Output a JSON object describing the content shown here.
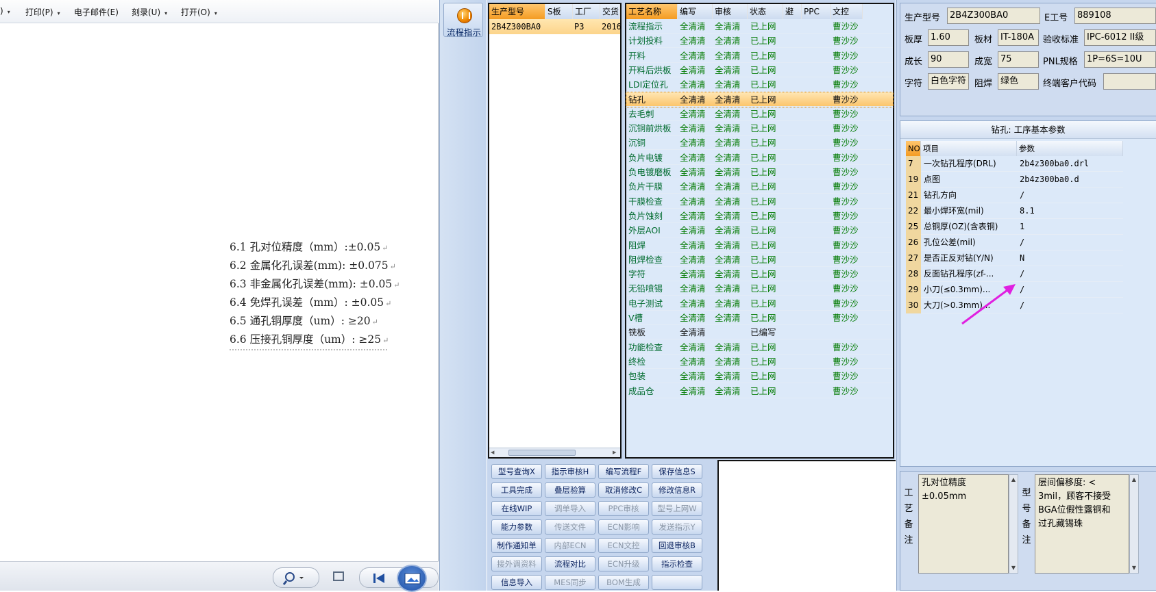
{
  "doc_toolbar": {
    "items": [
      {
        "label": ")",
        "arrow": "▾"
      },
      {
        "label": "打印(P)",
        "arrow": "▾"
      },
      {
        "label": "电子邮件(E)",
        "arrow": ""
      },
      {
        "label": "刻录(U)",
        "arrow": "▾"
      },
      {
        "label": "打开(O)",
        "arrow": "▾"
      }
    ]
  },
  "doc_lines": [
    "6.1 孔对位精度（mm）:±0.05",
    "6.2 金属化孔误差(mm): ±0.075",
    "6.3 非金属化孔误差(mm): ±0.05",
    "6.4 免焊孔误差（mm）: ±0.05",
    "6.5 通孔铜厚度（um）: ≥20",
    "6.6 压接孔铜厚度（um）: ≥25"
  ],
  "para_mark": "↵",
  "flow_button": {
    "label": "流程指示",
    "icon": "flow-indicator-icon"
  },
  "model_grid": {
    "headers": [
      "生产型号",
      "S板",
      "工厂",
      "交货"
    ],
    "row": [
      "2B4Z300BA0",
      "",
      "P3",
      "2016"
    ]
  },
  "process_grid": {
    "headers": [
      "工艺名称",
      "编写",
      "审核",
      "状态",
      "避",
      "PPC",
      "文控"
    ],
    "rows": [
      [
        "流程指示",
        "全清清",
        "全清清",
        "已上网",
        "",
        "",
        "曹沙沙"
      ],
      [
        "计划投料",
        "全清清",
        "全清清",
        "已上网",
        "",
        "",
        "曹沙沙"
      ],
      [
        "开料",
        "全清清",
        "全清清",
        "已上网",
        "",
        "",
        "曹沙沙"
      ],
      [
        "开料后烘板",
        "全清清",
        "全清清",
        "已上网",
        "",
        "",
        "曹沙沙"
      ],
      [
        "LDI定位孔",
        "全清清",
        "全清清",
        "已上网",
        "",
        "",
        "曹沙沙"
      ],
      [
        "钻孔",
        "全清清",
        "全清清",
        "已上网",
        "",
        "",
        "曹沙沙"
      ],
      [
        "去毛刺",
        "全清清",
        "全清清",
        "已上网",
        "",
        "",
        "曹沙沙"
      ],
      [
        "沉铜前烘板",
        "全清清",
        "全清清",
        "已上网",
        "",
        "",
        "曹沙沙"
      ],
      [
        "沉铜",
        "全清清",
        "全清清",
        "已上网",
        "",
        "",
        "曹沙沙"
      ],
      [
        "负片电镀",
        "全清清",
        "全清清",
        "已上网",
        "",
        "",
        "曹沙沙"
      ],
      [
        "负电镀磨板",
        "全清清",
        "全清清",
        "已上网",
        "",
        "",
        "曹沙沙"
      ],
      [
        "负片干膜",
        "全清清",
        "全清清",
        "已上网",
        "",
        "",
        "曹沙沙"
      ],
      [
        "干膜检查",
        "全清清",
        "全清清",
        "已上网",
        "",
        "",
        "曹沙沙"
      ],
      [
        "负片蚀刻",
        "全清清",
        "全清清",
        "已上网",
        "",
        "",
        "曹沙沙"
      ],
      [
        "外层AOI",
        "全清清",
        "全清清",
        "已上网",
        "",
        "",
        "曹沙沙"
      ],
      [
        "阻焊",
        "全清清",
        "全清清",
        "已上网",
        "",
        "",
        "曹沙沙"
      ],
      [
        "阻焊检查",
        "全清清",
        "全清清",
        "已上网",
        "",
        "",
        "曹沙沙"
      ],
      [
        "字符",
        "全清清",
        "全清清",
        "已上网",
        "",
        "",
        "曹沙沙"
      ],
      [
        "无铅喷锡",
        "全清清",
        "全清清",
        "已上网",
        "",
        "",
        "曹沙沙"
      ],
      [
        "电子测试",
        "全清清",
        "全清清",
        "已上网",
        "",
        "",
        "曹沙沙"
      ],
      [
        "V槽",
        "全清清",
        "全清清",
        "已上网",
        "",
        "",
        "曹沙沙"
      ],
      [
        "铣板",
        "全清清",
        "",
        "已编写",
        "",
        "",
        ""
      ],
      [
        "功能检查",
        "全清清",
        "全清清",
        "已上网",
        "",
        "",
        "曹沙沙"
      ],
      [
        "终检",
        "全清清",
        "全清清",
        "已上网",
        "",
        "",
        "曹沙沙"
      ],
      [
        "包装",
        "全清清",
        "全清清",
        "已上网",
        "",
        "",
        "曹沙沙"
      ],
      [
        "成品仓",
        "全清清",
        "全清清",
        "已上网",
        "",
        "",
        "曹沙沙"
      ]
    ],
    "selected_row": 5
  },
  "action_buttons": [
    {
      "label": "型号查询X",
      "enabled": true
    },
    {
      "label": "指示审核H",
      "enabled": true
    },
    {
      "label": "编写流程F",
      "enabled": true
    },
    {
      "label": "保存信息S",
      "enabled": true
    },
    {
      "label": "工具完成",
      "enabled": true
    },
    {
      "label": "叠层验算",
      "enabled": true
    },
    {
      "label": "取消修改C",
      "enabled": true
    },
    {
      "label": "修改信息R",
      "enabled": true
    },
    {
      "label": "在线WIP",
      "enabled": true
    },
    {
      "label": "调单导入",
      "enabled": false
    },
    {
      "label": "PPC审核",
      "enabled": false
    },
    {
      "label": "型号上网W",
      "enabled": false
    },
    {
      "label": "能力参数",
      "enabled": true
    },
    {
      "label": "传送文件",
      "enabled": false
    },
    {
      "label": "ECN影响",
      "enabled": false
    },
    {
      "label": "发送指示Y",
      "enabled": false
    },
    {
      "label": "制作通知单",
      "enabled": true
    },
    {
      "label": "内部ECN",
      "enabled": false
    },
    {
      "label": "ECN文控",
      "enabled": false
    },
    {
      "label": "回退审核B",
      "enabled": true
    },
    {
      "label": "接外调资料",
      "enabled": false
    },
    {
      "label": "流程对比",
      "enabled": true
    },
    {
      "label": "ECN升级",
      "enabled": false
    },
    {
      "label": "指示检查",
      "enabled": true
    },
    {
      "label": "信息导入",
      "enabled": true
    },
    {
      "label": "MES同步",
      "enabled": false
    },
    {
      "label": "BOM生成",
      "enabled": false
    },
    {
      "label": "",
      "enabled": true
    }
  ],
  "info": {
    "product_model": {
      "label": "生产型号",
      "value": "2B4Z300BA0"
    },
    "e_job": {
      "label": "E工号",
      "value": "889108"
    },
    "board_thickness": {
      "label": "板厚",
      "value": "1.60"
    },
    "board_material": {
      "label": "板材",
      "value": "IT-180A"
    },
    "acceptance_std": {
      "label": "验收标准",
      "value": "IPC-6012 II级"
    },
    "length": {
      "label": "成长",
      "value": "90"
    },
    "width": {
      "label": "成宽",
      "value": "75"
    },
    "pnl_spec": {
      "label": "PNL规格",
      "value": "1P=6S=10U"
    },
    "legend": {
      "label": "字符",
      "value": "白色字符"
    },
    "solder_mask": {
      "label": "阻焊",
      "value": "绿色"
    },
    "end_customer": {
      "label": "终端客户代码",
      "value": ""
    }
  },
  "params": {
    "title": "钻孔: 工序基本参数",
    "headers": [
      "NO",
      "项目",
      "参数"
    ],
    "rows": [
      [
        "7",
        "一次钻孔程序(DRL)",
        "2b4z300ba0.drl"
      ],
      [
        "19",
        "点图",
        "2b4z300ba0.d"
      ],
      [
        "21",
        "钻孔方向",
        "/"
      ],
      [
        "22",
        "最小焊环宽(mil)",
        "8.1"
      ],
      [
        "25",
        "总铜厚(OZ)(含表铜)",
        "1"
      ],
      [
        "26",
        "孔位公差(mil)",
        "/"
      ],
      [
        "27",
        "是否正反对钻(Y/N)",
        "N"
      ],
      [
        "28",
        "反面钻孔程序(zf-...",
        "/"
      ],
      [
        "29",
        "小刀(≤0.3mm)...",
        "/"
      ],
      [
        "30",
        "大刀(>0.3mm)...",
        "/"
      ]
    ],
    "arrow_color": "#e020e0"
  },
  "notes": {
    "process_label": "工艺备注",
    "process_text": "孔对位精度\n±0.05mm",
    "model_label": "型号备注",
    "model_text": "层间偏移度: <\n3mil，顾客不接受\nBGA位假性露铜和\n过孔藏锡珠"
  },
  "colors": {
    "accent_orange": "#f49b22",
    "status_green": "#007a00",
    "panel_blue": "#c6d6ee",
    "selection": "#fbc56c"
  }
}
